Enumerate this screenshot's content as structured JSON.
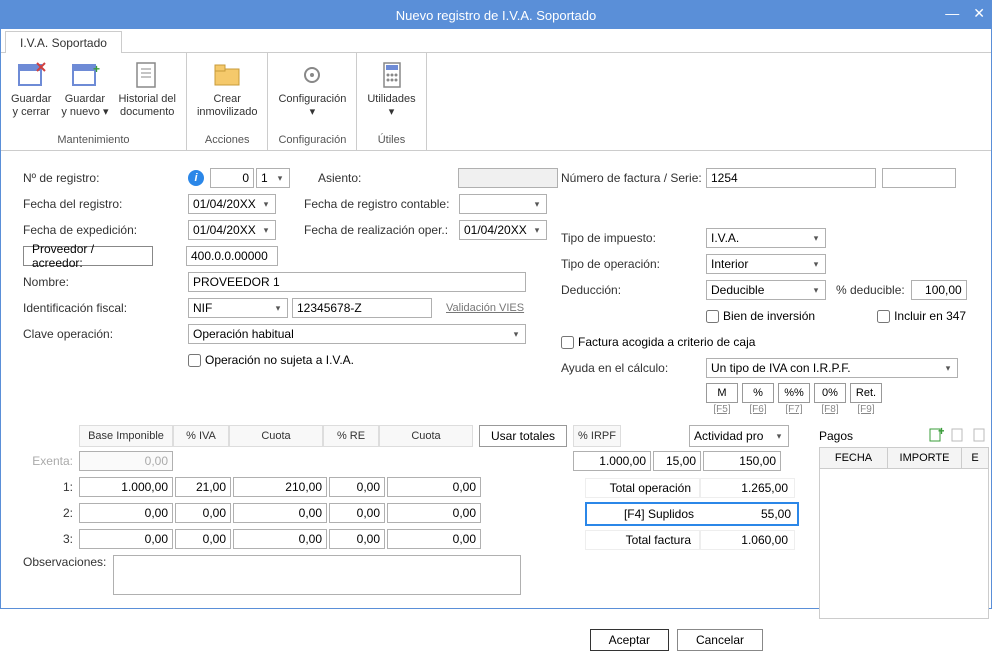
{
  "window": {
    "title": "Nuevo registro de I.V.A. Soportado"
  },
  "tab": "I.V.A. Soportado",
  "ribbon": {
    "groups": [
      {
        "name": "Mantenimiento",
        "items": [
          {
            "label": "Guardar\ny cerrar"
          },
          {
            "label": "Guardar\ny nuevo ▾"
          },
          {
            "label": "Historial del\ndocumento"
          }
        ]
      },
      {
        "name": "Acciones",
        "items": [
          {
            "label": "Crear\ninmovilizado"
          }
        ]
      },
      {
        "name": "Configuración",
        "items": [
          {
            "label": "Configuración\n ▾"
          }
        ]
      },
      {
        "name": "Útiles",
        "items": [
          {
            "label": "Utilidades\n ▾"
          }
        ]
      }
    ]
  },
  "labels": {
    "nregistro": "Nº de registro:",
    "fecharegistro": "Fecha del registro:",
    "fechaexped": "Fecha de expedición:",
    "proveedor": "Proveedor / acreedor:",
    "nombre": "Nombre:",
    "idfiscal": "Identificación fiscal:",
    "claveop": "Clave operación:",
    "opnosujeta": "Operación no sujeta a I.V.A.",
    "asiento": "Asiento:",
    "fechacontable": "Fecha de registro contable:",
    "fechareal": "Fecha de realización oper.:",
    "numfactura": "Número de factura / Serie:",
    "tipoimpuesto": "Tipo de impuesto:",
    "tipooperacion": "Tipo de operación:",
    "deduccion": "Deducción:",
    "pctdeducible": "% deducible:",
    "bieninversion": "Bien de inversión",
    "incluir347": "Incluir en 347",
    "facturacriterio": "Factura acogida a criterio de caja",
    "ayudacalculo": "Ayuda en el cálculo:",
    "observaciones": "Observaciones:",
    "validacionvies": "Validación VIES"
  },
  "values": {
    "nregistro_a": "0",
    "nregistro_b": "1",
    "fecharegistro": "01/04/20XX",
    "fechaexped": "01/04/20XX",
    "fechareal": "01/04/20XX",
    "proveedor": "400.0.0.00000",
    "nombre": "PROVEEDOR 1",
    "idtipo": "NIF",
    "idnum": "12345678-Z",
    "claveop": "Operación habitual",
    "numfactura": "1254",
    "serie": "",
    "tipoimpuesto": "I.V.A.",
    "tipooperacion": "Interior",
    "deduccion": "Deducible",
    "pctdeducible": "100,00",
    "ayudacalculo": "Un tipo de IVA con I.R.P.F.",
    "asiento": ""
  },
  "calcbtns": [
    "M",
    "%",
    "%%",
    "0%",
    "Ret."
  ],
  "calchints": [
    "[F5]",
    "[F6]",
    "[F7]",
    "[F8]",
    "[F9]"
  ],
  "grid": {
    "headers": {
      "base": "Base Imponible",
      "pctiva": "% IVA",
      "cuota": "Cuota",
      "pctre": "% RE",
      "cuota2": "Cuota",
      "usartotales": "Usar totales",
      "pctirpf": "% IRPF",
      "actividad": "Actividad pro",
      "pagos": "Pagos"
    },
    "exenta_label": "Exenta:",
    "exenta": "0,00",
    "rows": [
      {
        "lbl": "1:",
        "base": "1.000,00",
        "pctiva": "21,00",
        "cuota": "210,00",
        "pctre": "0,00",
        "cuota2": "0,00"
      },
      {
        "lbl": "2:",
        "base": "0,00",
        "pctiva": "0,00",
        "cuota": "0,00",
        "pctre": "0,00",
        "cuota2": "0,00"
      },
      {
        "lbl": "3:",
        "base": "0,00",
        "pctiva": "0,00",
        "cuota": "0,00",
        "pctre": "0,00",
        "cuota2": "0,00"
      }
    ],
    "irpf_base": "1.000,00",
    "irpf_pct": "15,00",
    "irpf_val": "150,00",
    "total_op_lbl": "Total operación",
    "total_op": "1.265,00",
    "suplidos_lbl": "[F4] Suplidos",
    "suplidos": "55,00",
    "total_fac_lbl": "Total factura",
    "total_fac": "1.060,00",
    "pagos_headers": {
      "fecha": "FECHA",
      "importe": "IMPORTE",
      "e": "E"
    }
  },
  "buttons": {
    "aceptar": "Aceptar",
    "cancelar": "Cancelar"
  }
}
